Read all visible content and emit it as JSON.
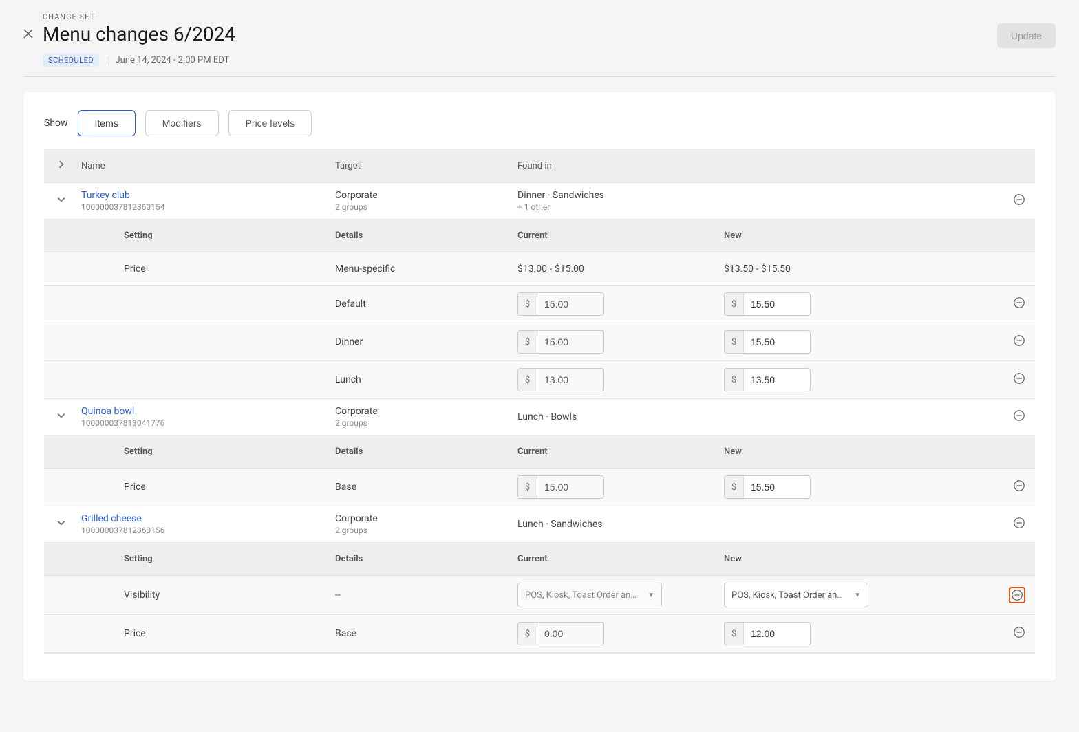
{
  "header": {
    "eyebrow": "CHANGE SET",
    "title": "Menu changes 6/2024",
    "badge": "SCHEDULED",
    "datetime": "June 14, 2024 - 2:00 PM EDT",
    "update_label": "Update"
  },
  "filters": {
    "show_label": "Show",
    "tabs": {
      "items": "Items",
      "modifiers": "Modifiers",
      "price_levels": "Price levels"
    },
    "active": "items"
  },
  "columns": {
    "name": "Name",
    "target": "Target",
    "found_in": "Found in",
    "setting": "Setting",
    "details": "Details",
    "current": "Current",
    "new": "New"
  },
  "currency": "$",
  "items": [
    {
      "name": "Turkey club",
      "id": "100000037812860154",
      "target": "Corporate",
      "target_sub": "2 groups",
      "found_in": "Dinner · Sandwiches",
      "found_in_sub": "+ 1 other",
      "settings": [
        {
          "setting": "Price",
          "details": "Menu-specific",
          "current_text": "$13.00 - $15.00",
          "new_text": "$13.50 - $15.50",
          "removable": false
        },
        {
          "setting": "",
          "details": "Default",
          "current_val": "15.00",
          "new_val": "15.50",
          "removable": true
        },
        {
          "setting": "",
          "details": "Dinner",
          "current_val": "15.00",
          "new_val": "15.50",
          "removable": true
        },
        {
          "setting": "",
          "details": "Lunch",
          "current_val": "13.00",
          "new_val": "13.50",
          "removable": true
        }
      ]
    },
    {
      "name": "Quinoa bowl",
      "id": "100000037813041776",
      "target": "Corporate",
      "target_sub": "2 groups",
      "found_in": "Lunch · Bowls",
      "found_in_sub": "",
      "settings": [
        {
          "setting": "Price",
          "details": "Base",
          "current_val": "15.00",
          "new_val": "15.50",
          "removable": true
        }
      ]
    },
    {
      "name": "Grilled cheese",
      "id": "100000037812860156",
      "target": "Corporate",
      "target_sub": "2 groups",
      "found_in": "Lunch · Sandwiches",
      "found_in_sub": "",
      "settings": [
        {
          "setting": "Visibility",
          "details": "--",
          "current_dd": "POS, Kiosk, Toast Order an…",
          "new_dd": "POS, Kiosk, Toast Order an…",
          "removable": true,
          "highlight": true
        },
        {
          "setting": "Price",
          "details": "Base",
          "current_val": "0.00",
          "new_val": "12.00",
          "removable": true
        }
      ]
    }
  ]
}
